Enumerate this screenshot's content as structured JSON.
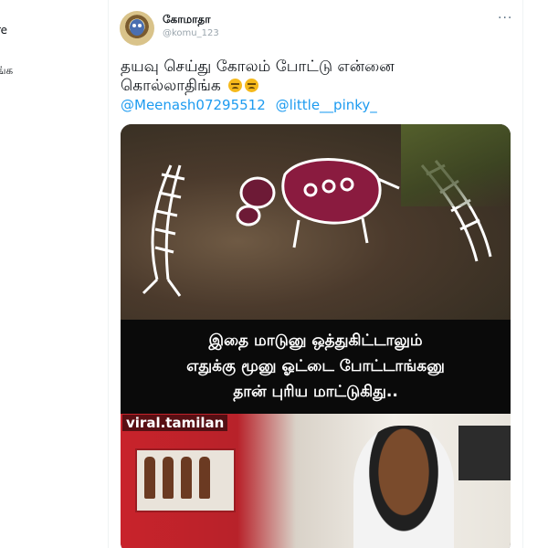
{
  "left_panel": {
    "items": [
      "re",
      "ங்க"
    ]
  },
  "tweet": {
    "author_name": "கோமாதா",
    "handle": "@komu_123",
    "more_label": "···",
    "text_line1": "தயவு செய்து கோலம் போட்டு என்னை",
    "text_line2": "கொல்லாதிங்க",
    "mentions": [
      "@Meenash07295512",
      "@little__pinky_"
    ],
    "emoji_icons": [
      "persevering-face-icon",
      "persevering-face-icon"
    ]
  },
  "media": {
    "caption_lines": [
      "இதை மாடுனு ஒத்துகிட்டாலும்",
      "எதுக்கு மூனு ஓட்டை போட்டாங்கனு",
      "தான் புரிய மாட்டுகிது.."
    ],
    "watermark": "viral.tamilan"
  },
  "colors": {
    "link": "#1d9bf0",
    "text": "#0f1419",
    "muted": "#9aa5ad",
    "divider": "#eff3f4"
  }
}
